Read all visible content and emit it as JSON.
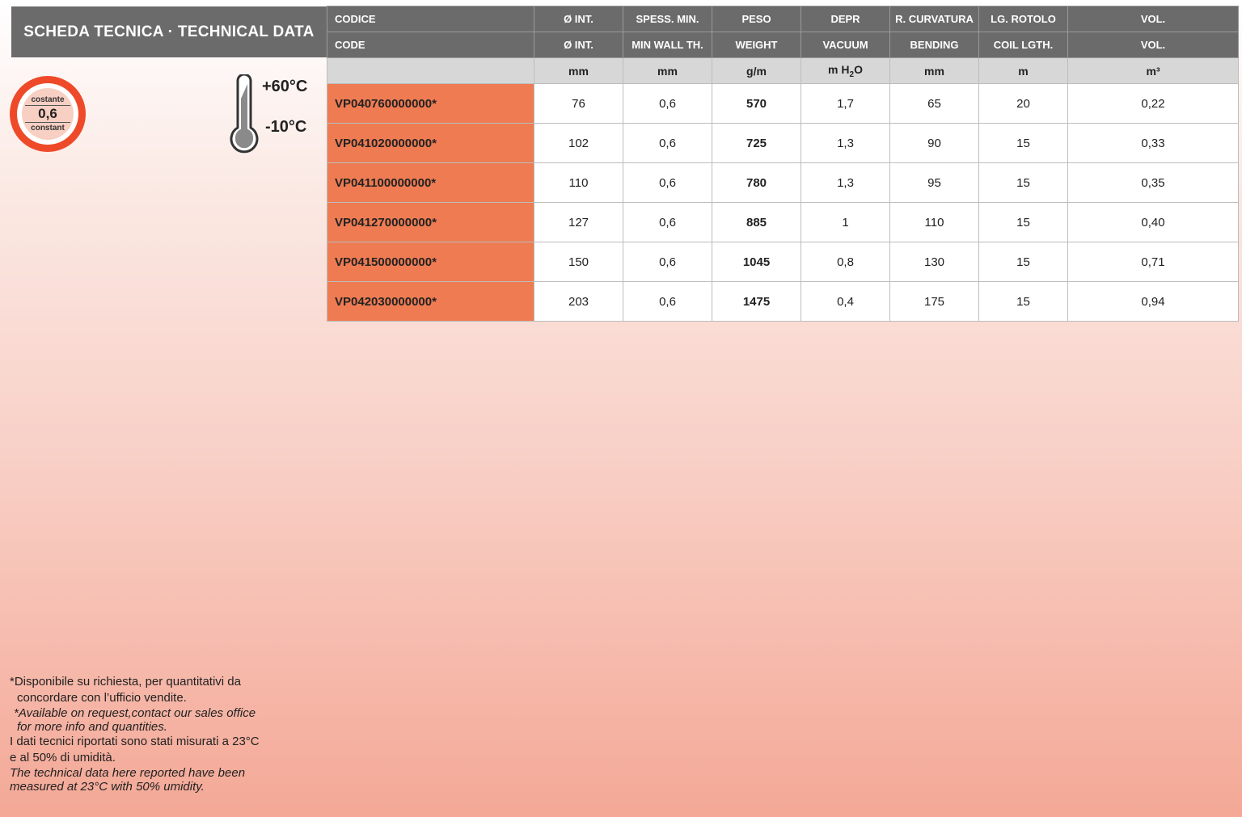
{
  "title": "SCHEDA TECNICA · TECHNICAL DATA",
  "badge": {
    "top": "costante",
    "value": "0,6",
    "bottom": "constant"
  },
  "temperature": {
    "max": "+60°C",
    "min": "-10°C"
  },
  "colors": {
    "accent": "#ee4a2a",
    "code_cell": "#ee7b52",
    "header": "#6b6b6b",
    "units_row": "#d7d7d7"
  },
  "table": {
    "headers_it": [
      "CODICE",
      "Ø INT.",
      "SPESS. MIN.",
      "PESO",
      "DEPR",
      "R. CURVATURA",
      "LG. ROTOLO",
      "VOL."
    ],
    "headers_en": [
      "CODE",
      "Ø INT.",
      "MIN WALL TH.",
      "WEIGHT",
      "VACUUM",
      "BENDING",
      "COIL LGTH.",
      "VOL."
    ],
    "units": [
      "",
      "mm",
      "mm",
      "g/m",
      "m H",
      "mm",
      "m",
      "m³"
    ],
    "unit_subscript": "2",
    "unit_suffix": "O",
    "rows": [
      [
        "VP040760000000*",
        "76",
        "0,6",
        "570",
        "1,7",
        "65",
        "20",
        "0,22"
      ],
      [
        "VP041020000000*",
        "102",
        "0,6",
        "725",
        "1,3",
        "90",
        "15",
        "0,33"
      ],
      [
        "VP041100000000*",
        "110",
        "0,6",
        "780",
        "1,3",
        "95",
        "15",
        "0,35"
      ],
      [
        "VP041270000000*",
        "127",
        "0,6",
        "885",
        "1",
        "110",
        "15",
        "0,40"
      ],
      [
        "VP041500000000*",
        "150",
        "0,6",
        "1045",
        "0,8",
        "130",
        "15",
        "0,71"
      ],
      [
        "VP042030000000*",
        "203",
        "0,6",
        "1475",
        "0,4",
        "175",
        "15",
        "0,94"
      ]
    ]
  },
  "notes": {
    "availability_it_1": "*Disponibile su richiesta, per quantitativi da",
    "availability_it_2": "concordare con l’ufficio vendite.",
    "availability_en_1": "*Available on request,contact our sales office",
    "availability_en_2": "for more info and quantities.",
    "conditions_it_1": "I dati tecnici riportati sono stati misurati a 23°C",
    "conditions_it_2": "e al 50% di umidità.",
    "conditions_en_1": "The technical data here reported have been",
    "conditions_en_2": "measured at 23°C with 50% umidity."
  }
}
